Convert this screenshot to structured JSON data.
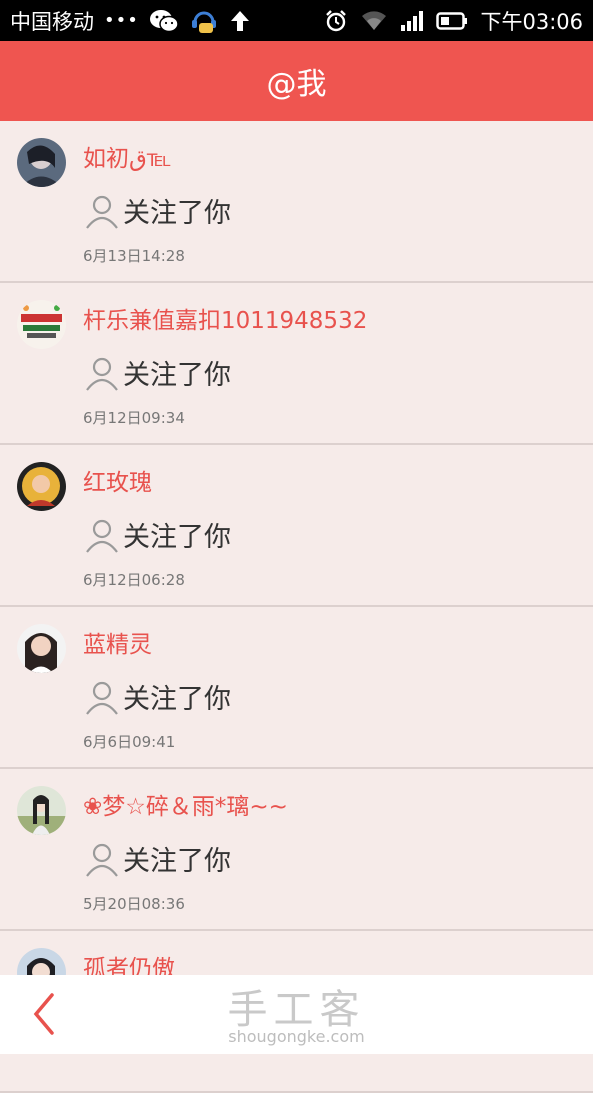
{
  "status_bar": {
    "carrier": "中国移动",
    "dots": "•••",
    "time": "下午03:06"
  },
  "header": {
    "title": "@我"
  },
  "items": [
    {
      "name": "如初ق℡",
      "action": "关注了你",
      "time": "6月13日14:28"
    },
    {
      "name": "杆乐兼值嘉扣1011948532",
      "action": "关注了你",
      "time": "6月12日09:34"
    },
    {
      "name": "红玫瑰",
      "action": "关注了你",
      "time": "6月12日06:28"
    },
    {
      "name": "蓝精灵",
      "action": "关注了你",
      "time": "6月6日09:41"
    },
    {
      "name": "❀梦☆碎＆雨*璃~~",
      "action": "关注了你",
      "time": "5月20日08:36"
    },
    {
      "name": "孤者仍傲",
      "action": "",
      "time": ""
    }
  ],
  "watermark": {
    "title": "手工客",
    "subtitle": "shougongke.com"
  },
  "colors": {
    "accent": "#ef5550",
    "name_text": "#e8524d",
    "background": "#f6ebe9"
  }
}
